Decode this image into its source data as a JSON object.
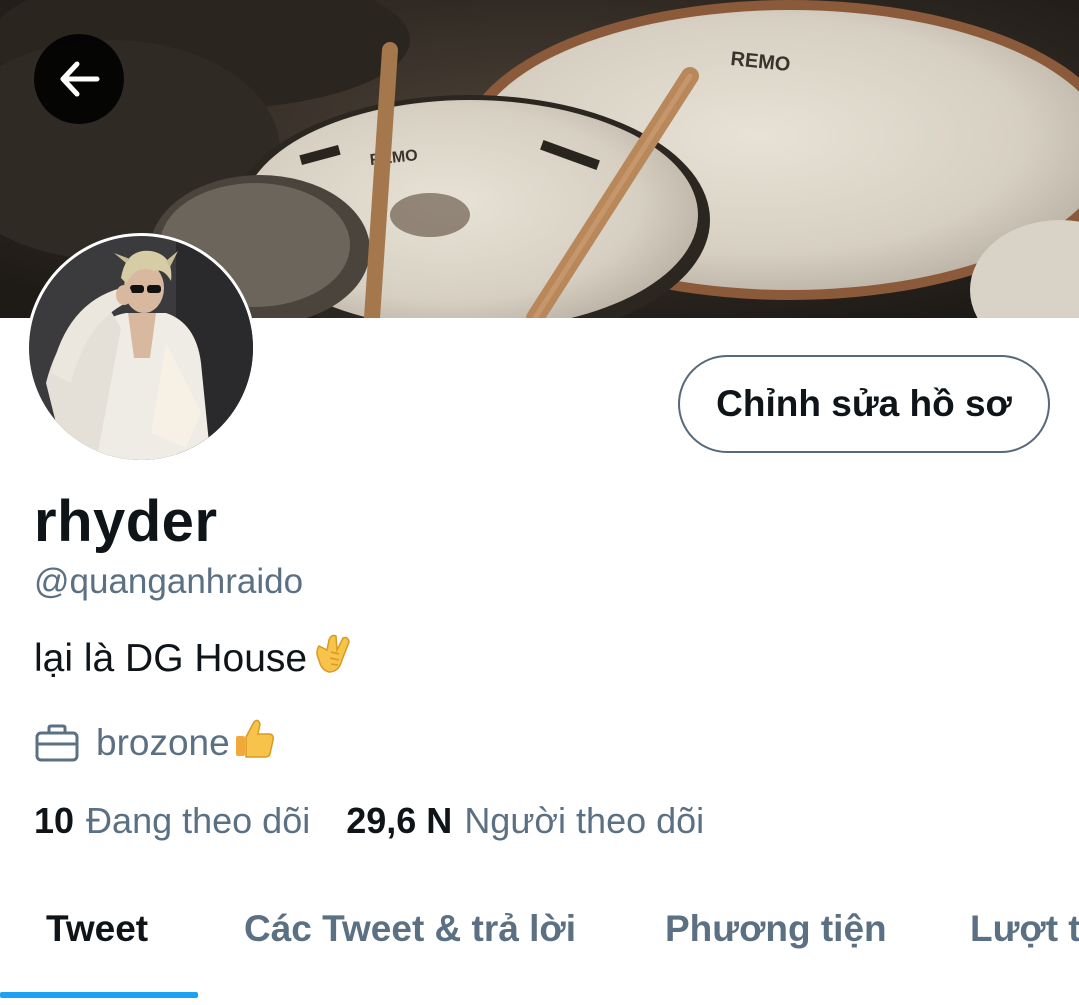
{
  "header": {
    "back_icon": "arrow-left-icon",
    "banner_description_icon": "drum-kit-banner"
  },
  "profile": {
    "display_name": "rhyder",
    "handle": "@quanganhraido",
    "bio": "lại là DG House",
    "bio_emoji": "call-me-hand-emoji",
    "location": "brozone",
    "location_icon": "briefcase-icon",
    "location_emoji": "thumbs-up-emoji",
    "edit_button_label": "Chỉnh sửa hồ sơ"
  },
  "stats": {
    "following_count": "10",
    "following_label": "Đang theo dõi",
    "followers_count": "29,6 N",
    "followers_label": "Người theo dõi"
  },
  "tabs": [
    {
      "label": "Tweet",
      "active": true
    },
    {
      "label": "Các Tweet & trả lời",
      "active": false
    },
    {
      "label": "Phương tiện",
      "active": false
    },
    {
      "label": "Lượt thích",
      "active": false
    }
  ],
  "colors": {
    "accent": "#1da1f2",
    "text_primary": "#0f1419",
    "text_secondary": "#5b7083",
    "button_border": "#56687a"
  }
}
